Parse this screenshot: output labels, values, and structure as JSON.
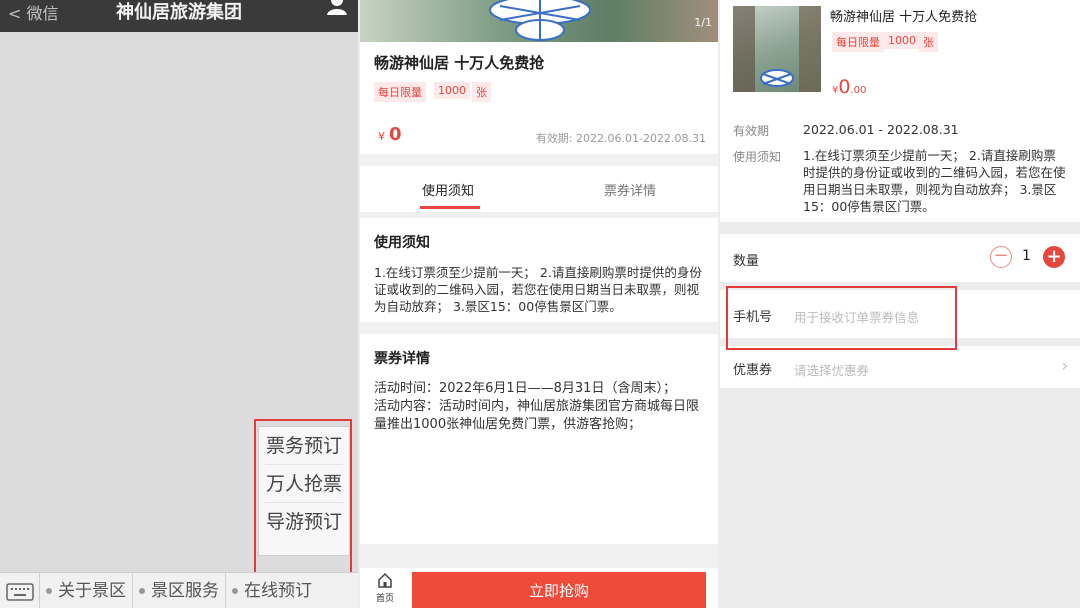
{
  "wechat": {
    "back_label": "< 微信",
    "title": "神仙居旅游集团",
    "popup_items": [
      "票务预订",
      "万人抢票",
      "导游预订"
    ],
    "menu_items": [
      "关于景区",
      "景区服务",
      "在线预订"
    ]
  },
  "detail": {
    "pager": "1/1",
    "product_name": "畅游神仙居 十万人免费抢",
    "tags": [
      "每日限量",
      "1000",
      "张"
    ],
    "currency": "¥",
    "price": "0",
    "validity": "有效期: 2022.06.01-2022.08.31",
    "tabs": [
      "使用须知",
      "票券详情"
    ],
    "usage_title": "使用须知",
    "usage_text": "1.在线订票须至少提前一天； 2.请直接刷购票时提供的身份证或收到的二维码入园，若您在使用日期当日未取票，则视为自动放弃； 3.景区15：00停售景区门票。",
    "ticket_title": "票券详情",
    "ticket_text_1": "活动时间：2022年6月1日——8月31日（含周末）；",
    "ticket_text_2": "活动内容：活动时间内，神仙居旅游集团官方商城每日限量推出1000张神仙居免费门票，供游客抢购；",
    "home_label": "首页",
    "buy_label": "立即抢购"
  },
  "order": {
    "product_name": "畅游神仙居 十万人免费抢",
    "tags": [
      "每日限量",
      "1000",
      "张"
    ],
    "currency": "¥",
    "price_int": "0",
    "price_dec": ".00",
    "validity_label": "有效期",
    "validity_value": "2022.06.01 - 2022.08.31",
    "notice_label": "使用须知",
    "notice_value": "1.在线订票须至少提前一天； 2.请直接刷购票时提供的身份证或收到的二维码入园，若您在使用日期当日未取票，则视为自动放弃； 3.景区15：00停售景区门票。",
    "qty_label": "数量",
    "qty_value": "1",
    "phone_label": "手机号",
    "phone_placeholder": "用于接收订单票券信息",
    "coupon_label": "优惠券",
    "coupon_placeholder": "请选择优惠券"
  },
  "colors": {
    "accent": "#e5473d",
    "highlight_box": "#e23b3b"
  }
}
